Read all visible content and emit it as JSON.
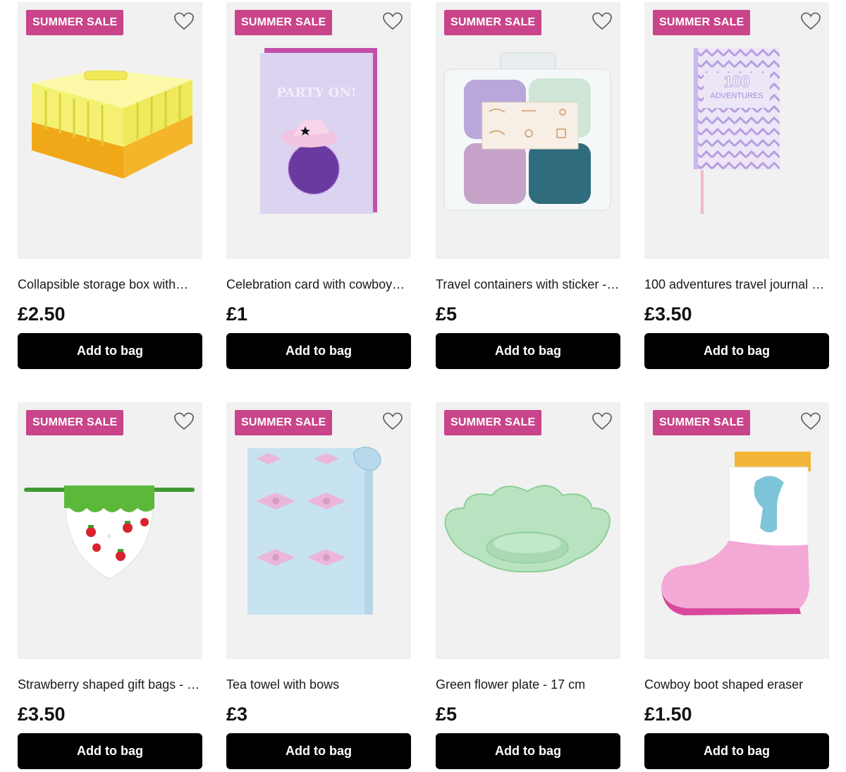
{
  "products": [
    {
      "badge": "SUMMER SALE",
      "name": "Collapsible storage box with…",
      "price": "£2.50",
      "button": "Add to bag",
      "image": "yellow collapsible storage crate"
    },
    {
      "badge": "SUMMER SALE",
      "name": "Celebration card with cowboy…",
      "price": "£1",
      "button": "Add to bag",
      "image": "party on greeting card with disco ball cowboy hat",
      "card_text": "PARTY ON!"
    },
    {
      "badge": "SUMMER SALE",
      "name": "Travel containers with sticker - …",
      "price": "£5",
      "button": "Add to bag",
      "image": "set of four pastel travel containers"
    },
    {
      "badge": "SUMMER SALE",
      "name": "100 adventures travel journal …",
      "price": "£3.50",
      "button": "Add to bag",
      "image": "lilac zigzag travel journal",
      "cover_number": "100",
      "cover_text": "ADVENTURES"
    },
    {
      "badge": "SUMMER SALE",
      "name": "Strawberry shaped gift bags - …",
      "price": "£3.50",
      "button": "Add to bag",
      "image": "strawberry shaped gift bag"
    },
    {
      "badge": "SUMMER SALE",
      "name": "Tea towel with bows",
      "price": "£3",
      "button": "Add to bag",
      "image": "blue tea towel with pink bows"
    },
    {
      "badge": "SUMMER SALE",
      "name": "Green flower plate - 17 cm",
      "price": "£5",
      "button": "Add to bag",
      "image": "green glass flower plate"
    },
    {
      "badge": "SUMMER SALE",
      "name": "Cowboy boot shaped eraser",
      "price": "£1.50",
      "button": "Add to bag",
      "image": "pink cowboy boot eraser"
    }
  ],
  "colors": {
    "badge": "#c9448a",
    "button": "#000000",
    "image_bg": "#f1f1f1"
  },
  "icons": {
    "favourite": "heart-outline-icon"
  }
}
